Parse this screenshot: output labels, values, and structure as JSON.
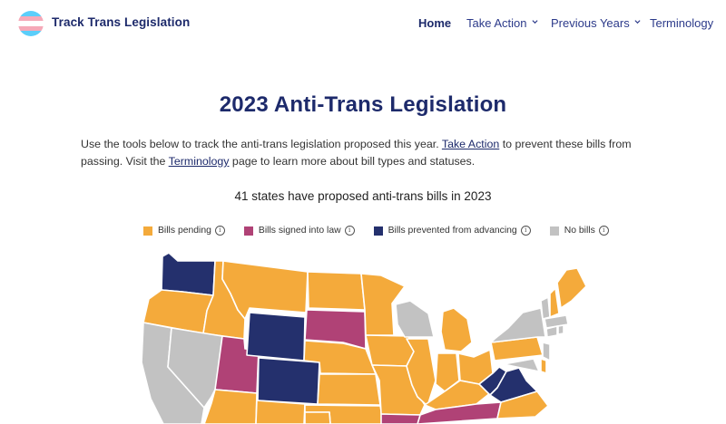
{
  "header": {
    "brand": "Track Trans Legislation",
    "nav": [
      {
        "label": "Home"
      },
      {
        "label": "Take Action"
      },
      {
        "label": "Previous Years"
      },
      {
        "label": "Terminology"
      }
    ]
  },
  "main": {
    "title": "2023 Anti-Trans Legislation",
    "intro": {
      "part1": "Use the tools below to track the anti-trans legislation proposed this year. ",
      "link1": "Take Action",
      "part2": " to prevent these bills from passing. Visit the ",
      "link2": "Terminology",
      "part3": " page to learn more about bill types and statuses."
    },
    "summary": "41 states have proposed anti-trans bills in 2023",
    "legend": [
      {
        "label": "Bills pending",
        "color": "#f4aa3b"
      },
      {
        "label": "Bills signed into law",
        "color": "#b04276"
      },
      {
        "label": "Bills prevented from advancing",
        "color": "#24306d"
      },
      {
        "label": "No bills",
        "color": "#c2c2c2"
      }
    ]
  },
  "colors": {
    "navy": "#1d2a6b",
    "trans_blue": "#5bcefa",
    "trans_pink": "#f5a9b8"
  }
}
